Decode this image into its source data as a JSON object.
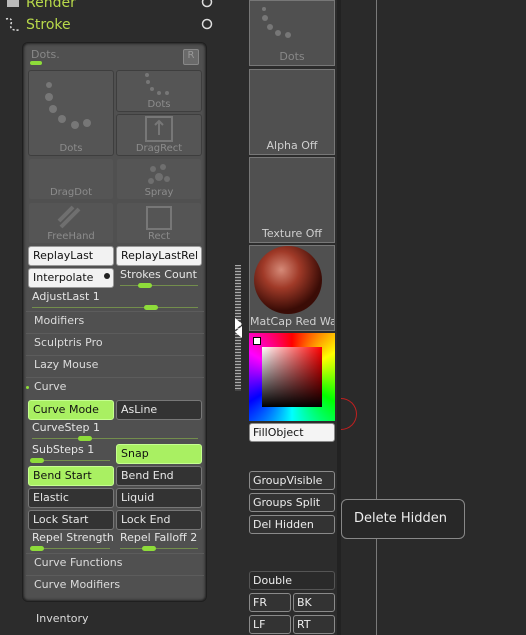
{
  "header": {
    "render_label": "Render",
    "stroke_label": "Stroke"
  },
  "panel": {
    "dots_title": "Dots.",
    "r_button": "R",
    "tiles": [
      "Dots",
      "Dots",
      "DragRect",
      "DragDot",
      "Spray",
      "FreeHand",
      "Rect"
    ],
    "replay_last": "ReplayLast",
    "replay_last_rel": "ReplayLastRel",
    "interpolate": "Interpolate",
    "strokes_count": "Strokes Count",
    "adjust_last": "AdjustLast 1",
    "modifiers": "Modifiers",
    "sculptris_pro": "Sculptris Pro",
    "lazy_mouse": "Lazy Mouse",
    "curve": "Curve",
    "curve_mode": "Curve Mode",
    "as_line": "AsLine",
    "curve_step": "CurveStep 1",
    "sub_steps": "SubSteps 1",
    "snap": "Snap",
    "bend_start": "Bend Start",
    "bend_end": "Bend End",
    "elastic": "Elastic",
    "liquid": "Liquid",
    "lock_start": "Lock Start",
    "lock_end": "Lock End",
    "repel_strength": "Repel Strength",
    "repel_falloff": "Repel Falloff 2",
    "curve_functions": "Curve Functions",
    "curve_modifiers": "Curve Modifiers",
    "inventory": "Inventory"
  },
  "right": {
    "dots_tile": "Dots",
    "alpha_off": "Alpha Off",
    "texture_off": "Texture Off",
    "matcap": "MatCap Red Wax",
    "fill_object": "FillObject",
    "group_visible": "GroupVisible",
    "groups_split": "Groups Split",
    "del_hidden": "Del Hidden",
    "double": "Double",
    "fr": "FR",
    "bk": "BK",
    "lf": "LF",
    "rt": "RT"
  },
  "tooltip": {
    "text": "Delete Hidden"
  },
  "colors": {
    "accent_green": "#a9f062",
    "header_green": "#b8d94a"
  }
}
